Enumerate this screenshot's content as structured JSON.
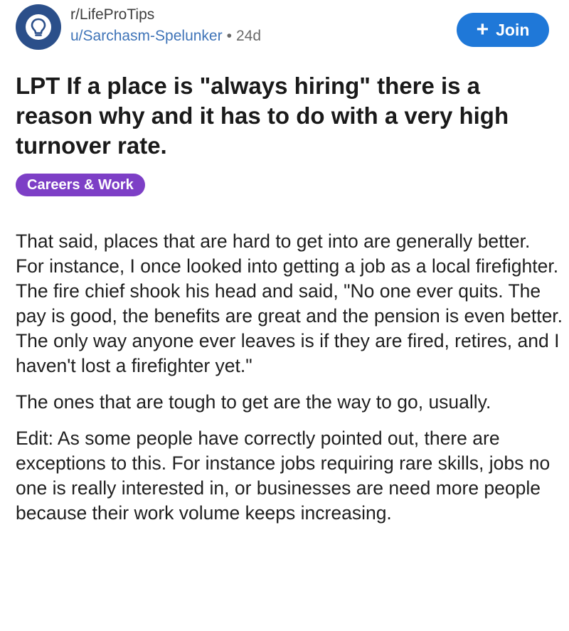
{
  "post": {
    "subreddit": "r/LifeProTips",
    "author": "u/Sarchasm-Spelunker",
    "separator": "•",
    "age": "24d",
    "join_label": "Join",
    "join_plus": "+",
    "title": "LPT If a place is \"always hiring\" there is a reason why and it has to do with a very high turnover rate.",
    "flair": "Careers & Work",
    "paragraphs": [
      "That said, places that are hard to get into are generally better. For instance, I once looked into getting a job as a local firefighter. The fire chief shook his head and said, \"No one ever quits. The pay is good, the benefits are great and the pension is even better. The only way anyone ever leaves is if they are fired, retires, and I haven't lost a firefighter yet.\"",
      "The ones that are tough to get are the way to go, usually.",
      "Edit: As some people have correctly pointed out, there are exceptions to this. For instance jobs requiring rare skills, jobs no one is really interested in, or businesses are need more people because their work volume keeps increasing."
    ]
  },
  "icons": {
    "subreddit_avatar": "lightbulb-icon",
    "join": "plus-icon"
  },
  "colors": {
    "avatar_bg": "#2b4f8a",
    "author_link": "#3f74b8",
    "join_button": "#1f78d8",
    "flair_bg": "#7d3fc6"
  }
}
